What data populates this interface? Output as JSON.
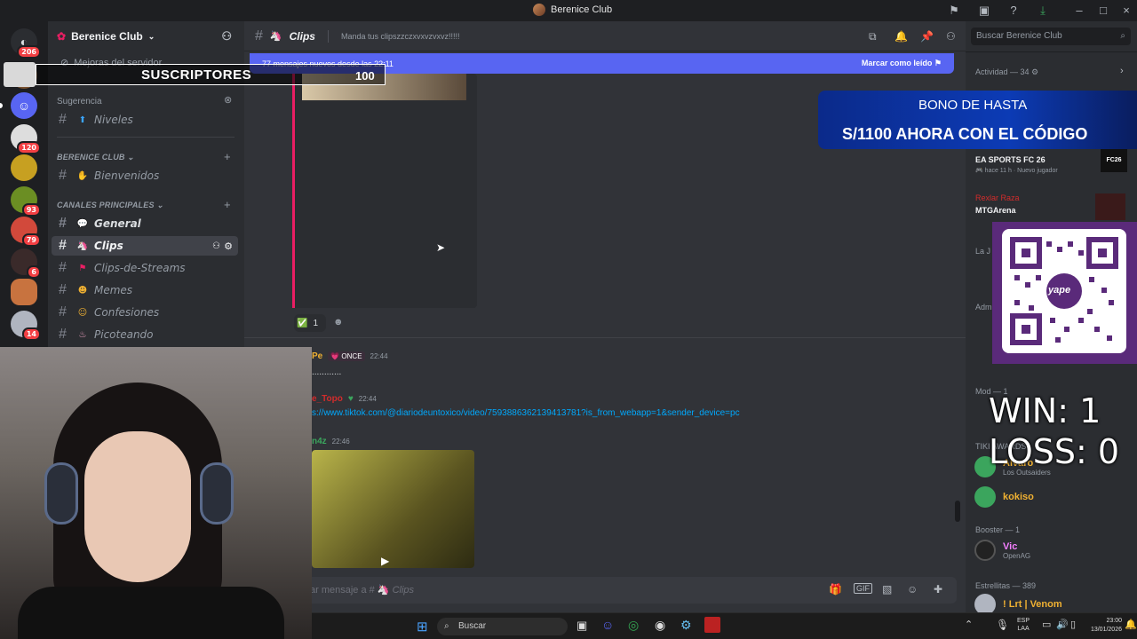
{
  "window": {
    "title": "Berenice Club"
  },
  "server": {
    "name": "Berenice Club",
    "boost_item": "Mejoras del servidor"
  },
  "guild_badges": [
    "206",
    "120",
    "93",
    "79",
    "6",
    "14"
  ],
  "sidebar": {
    "sugerencia_label": "Sugerencia",
    "niveles": "Niveles",
    "section_club": "BERENICE CLUB",
    "bienvenidos": "Bienvenidos",
    "section_main": "CANALES PRINCIPALES",
    "channels": [
      "General",
      "Clips",
      "Clips-de-Streams",
      "Memes",
      "Confesiones",
      "Picoteando"
    ]
  },
  "chat": {
    "channel": "Clips",
    "topic": "Manda tus clipszzczxvxvzvxvz!!!!!",
    "new_messages": "77 mensajes nuevos desde las 22:11",
    "mark_read": "Marcar como leído",
    "reaction_count": "1",
    "msg1": {
      "author": "Pe",
      "tag": "ONCE",
      "time": "22:44",
      "text": "............"
    },
    "msg2": {
      "author": "e_Topo",
      "time": "22:44",
      "link": "s://www.tiktok.com/@diariodeuntoxico/video/7593886362139413781?is_from_webapp=1&sender_device=pc"
    },
    "msg3": {
      "author": "n4z",
      "time": "22:46"
    },
    "composer_placeholder": "ar mensaje a #",
    "composer_channel": "Clips"
  },
  "members": {
    "search_placeholder": "Buscar Berenice Club",
    "activity": "Actividad — 34",
    "ea_title": "EA SPORTS FC 26",
    "ea_sub_time": "hace 11 h",
    "ea_sub_status": "Nuevo jugador",
    "ea_badge": "FC26",
    "mtg_user": "Rexlar Raza",
    "mtg_title": "MTGArena",
    "la_section": "La J",
    "adm_section": "Adm",
    "mod_section": "Mod — 1",
    "tiki_section": "TIKI AWARDS",
    "alvaro": "Alvaro",
    "alvaro_sub": "Los Outsaiders",
    "kokiso": "kokiso",
    "booster_section": "Booster — 1",
    "vic": "Vic",
    "vic_sub": "OpenAG",
    "estrellitas_section": "Estrellitas — 389",
    "lrt": "! Lrt | Venom"
  },
  "overlays": {
    "suscriptores": "SUSCRIPTORES",
    "sub_count": "100",
    "bono_line1": "BONO DE HASTA",
    "bono_line2": "S/1100 AHORA CON EL CÓDIGO",
    "yape": "yape",
    "win": "WIN: 1",
    "loss": "LOSS: 0"
  },
  "taskbar": {
    "search": "Buscar",
    "lang1": "ESP",
    "lang2": "LAA",
    "time": "23:00",
    "date": "13/01/2026"
  },
  "colors": {
    "blurple": "#5865f2",
    "accent_pink": "#e91e63"
  }
}
